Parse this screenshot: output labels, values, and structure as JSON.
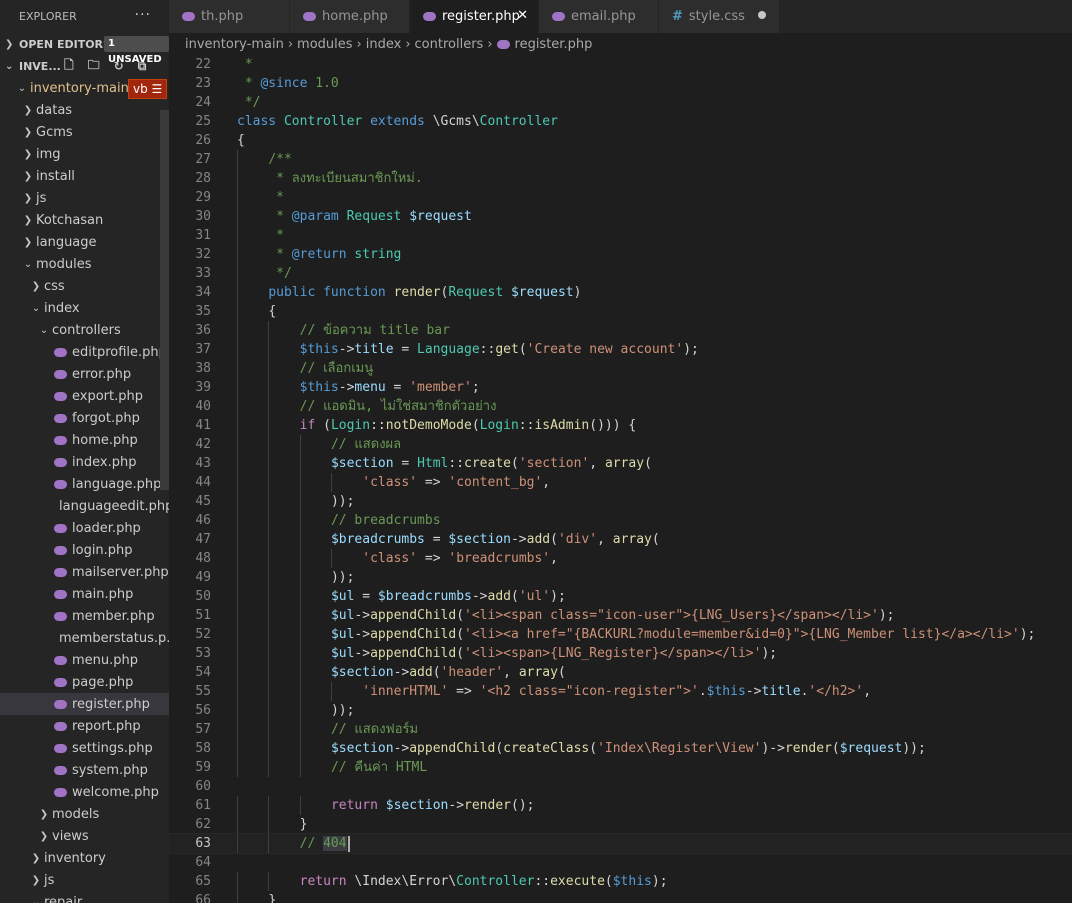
{
  "sidebar": {
    "title": "EXPLORER",
    "more": "···",
    "open_editors": "OPEN EDITORS",
    "unsaved": "1 UNSAVED",
    "workspace": "INVE...",
    "root_folder": "inventory-main",
    "root_badge": "vb",
    "tree": [
      {
        "label": "datas",
        "depth": 1,
        "type": "folder",
        "open": false
      },
      {
        "label": "Gcms",
        "depth": 1,
        "type": "folder",
        "open": false
      },
      {
        "label": "img",
        "depth": 1,
        "type": "folder",
        "open": false
      },
      {
        "label": "install",
        "depth": 1,
        "type": "folder",
        "open": false
      },
      {
        "label": "js",
        "depth": 1,
        "type": "folder",
        "open": false
      },
      {
        "label": "Kotchasan",
        "depth": 1,
        "type": "folder",
        "open": false
      },
      {
        "label": "language",
        "depth": 1,
        "type": "folder",
        "open": false
      },
      {
        "label": "modules",
        "depth": 1,
        "type": "folder",
        "open": true
      },
      {
        "label": "css",
        "depth": 2,
        "type": "folder",
        "open": false
      },
      {
        "label": "index",
        "depth": 2,
        "type": "folder",
        "open": true
      },
      {
        "label": "controllers",
        "depth": 3,
        "type": "folder",
        "open": true
      },
      {
        "label": "editprofile.php",
        "depth": 4,
        "type": "php"
      },
      {
        "label": "error.php",
        "depth": 4,
        "type": "php"
      },
      {
        "label": "export.php",
        "depth": 4,
        "type": "php"
      },
      {
        "label": "forgot.php",
        "depth": 4,
        "type": "php"
      },
      {
        "label": "home.php",
        "depth": 4,
        "type": "php"
      },
      {
        "label": "index.php",
        "depth": 4,
        "type": "php"
      },
      {
        "label": "language.php",
        "depth": 4,
        "type": "php"
      },
      {
        "label": "languageedit.php",
        "depth": 4,
        "type": "php"
      },
      {
        "label": "loader.php",
        "depth": 4,
        "type": "php"
      },
      {
        "label": "login.php",
        "depth": 4,
        "type": "php"
      },
      {
        "label": "mailserver.php",
        "depth": 4,
        "type": "php"
      },
      {
        "label": "main.php",
        "depth": 4,
        "type": "php"
      },
      {
        "label": "member.php",
        "depth": 4,
        "type": "php"
      },
      {
        "label": "memberstatus.p...",
        "depth": 4,
        "type": "php"
      },
      {
        "label": "menu.php",
        "depth": 4,
        "type": "php"
      },
      {
        "label": "page.php",
        "depth": 4,
        "type": "php"
      },
      {
        "label": "register.php",
        "depth": 4,
        "type": "php",
        "selected": true
      },
      {
        "label": "report.php",
        "depth": 4,
        "type": "php"
      },
      {
        "label": "settings.php",
        "depth": 4,
        "type": "php"
      },
      {
        "label": "system.php",
        "depth": 4,
        "type": "php"
      },
      {
        "label": "welcome.php",
        "depth": 4,
        "type": "php"
      },
      {
        "label": "models",
        "depth": 3,
        "type": "folder",
        "open": false
      },
      {
        "label": "views",
        "depth": 3,
        "type": "folder",
        "open": false
      },
      {
        "label": "inventory",
        "depth": 2,
        "type": "folder",
        "open": false
      },
      {
        "label": "js",
        "depth": 2,
        "type": "folder",
        "open": false
      },
      {
        "label": "repair",
        "depth": 2,
        "type": "folder",
        "open": true
      }
    ]
  },
  "tabs": [
    {
      "label": "th.php",
      "icon": "php-icon",
      "width": 121
    },
    {
      "label": "home.php",
      "icon": "php-icon",
      "width": 120
    },
    {
      "label": "register.php",
      "icon": "php-icon",
      "width": 129,
      "active": true
    },
    {
      "label": "email.php",
      "icon": "php-icon",
      "width": 120
    },
    {
      "label": "style.css",
      "icon": "css-icon",
      "width": 121,
      "dirty": true
    }
  ],
  "breadcrumb": [
    "inventory-main",
    "modules",
    "index",
    "controllers",
    "register.php"
  ],
  "editor": {
    "current_line": 63,
    "lines": [
      {
        "n": "22",
        "indent": 0,
        "tokens": [
          [
            " *",
            "c"
          ]
        ]
      },
      {
        "n": "23",
        "indent": 0,
        "tokens": [
          [
            " * ",
            "c"
          ],
          [
            "@since",
            "k"
          ],
          [
            " 1.0",
            "c"
          ]
        ]
      },
      {
        "n": "24",
        "indent": 0,
        "tokens": [
          [
            " */",
            "c"
          ]
        ]
      },
      {
        "n": "25",
        "indent": 0,
        "tokens": [
          [
            "class",
            "k"
          ],
          [
            " ",
            "d"
          ],
          [
            "Controller",
            "t"
          ],
          [
            " ",
            "d"
          ],
          [
            "extends",
            "k"
          ],
          [
            " \\Gcms\\",
            "d"
          ],
          [
            "Controller",
            "t"
          ]
        ]
      },
      {
        "n": "26",
        "indent": 0,
        "tokens": [
          [
            "{",
            "d"
          ]
        ]
      },
      {
        "n": "27",
        "indent": 1,
        "tokens": [
          [
            "/**",
            "c"
          ]
        ]
      },
      {
        "n": "28",
        "indent": 1,
        "tokens": [
          [
            " * ลงทะเบียนสมาชิกใหม่.",
            "c"
          ]
        ]
      },
      {
        "n": "29",
        "indent": 1,
        "tokens": [
          [
            " *",
            "c"
          ]
        ]
      },
      {
        "n": "30",
        "indent": 1,
        "tokens": [
          [
            " * ",
            "c"
          ],
          [
            "@param",
            "k"
          ],
          [
            " ",
            "c"
          ],
          [
            "Request",
            "t"
          ],
          [
            " ",
            "c"
          ],
          [
            "$request",
            "v"
          ]
        ]
      },
      {
        "n": "31",
        "indent": 1,
        "tokens": [
          [
            " *",
            "c"
          ]
        ]
      },
      {
        "n": "32",
        "indent": 1,
        "tokens": [
          [
            " * ",
            "c"
          ],
          [
            "@return",
            "k"
          ],
          [
            " ",
            "c"
          ],
          [
            "string",
            "t"
          ]
        ]
      },
      {
        "n": "33",
        "indent": 1,
        "tokens": [
          [
            " */",
            "c"
          ]
        ]
      },
      {
        "n": "34",
        "indent": 1,
        "tokens": [
          [
            "public",
            "k"
          ],
          [
            " ",
            "d"
          ],
          [
            "function",
            "k"
          ],
          [
            " ",
            "d"
          ],
          [
            "render",
            "f"
          ],
          [
            "(",
            "d"
          ],
          [
            "Request",
            "t"
          ],
          [
            " ",
            "d"
          ],
          [
            "$request",
            "v"
          ],
          [
            ")",
            "d"
          ]
        ]
      },
      {
        "n": "35",
        "indent": 1,
        "tokens": [
          [
            "{",
            "d"
          ]
        ]
      },
      {
        "n": "36",
        "indent": 2,
        "tokens": [
          [
            "// ข้อความ title bar",
            "c"
          ]
        ]
      },
      {
        "n": "37",
        "indent": 2,
        "tokens": [
          [
            "$this",
            "k"
          ],
          [
            "->",
            "d"
          ],
          [
            "title",
            "v"
          ],
          [
            " = ",
            "d"
          ],
          [
            "Language",
            "t"
          ],
          [
            "::",
            "d"
          ],
          [
            "get",
            "f"
          ],
          [
            "(",
            "d"
          ],
          [
            "'Create new account'",
            "s"
          ],
          [
            ");",
            "d"
          ]
        ]
      },
      {
        "n": "38",
        "indent": 2,
        "tokens": [
          [
            "// เลือกเมนู",
            "c"
          ]
        ]
      },
      {
        "n": "39",
        "indent": 2,
        "tokens": [
          [
            "$this",
            "k"
          ],
          [
            "->",
            "d"
          ],
          [
            "menu",
            "v"
          ],
          [
            " = ",
            "d"
          ],
          [
            "'member'",
            "s"
          ],
          [
            ";",
            "d"
          ]
        ]
      },
      {
        "n": "40",
        "indent": 2,
        "tokens": [
          [
            "// แอดมิน, ไม่ใช่สมาชิกตัวอย่าง",
            "c"
          ]
        ]
      },
      {
        "n": "41",
        "indent": 2,
        "tokens": [
          [
            "if",
            "ctl"
          ],
          [
            " (",
            "d"
          ],
          [
            "Login",
            "t"
          ],
          [
            "::",
            "d"
          ],
          [
            "notDemoMode",
            "f"
          ],
          [
            "(",
            "d"
          ],
          [
            "Login",
            "t"
          ],
          [
            "::",
            "d"
          ],
          [
            "isAdmin",
            "f"
          ],
          [
            "())) {",
            "d"
          ]
        ]
      },
      {
        "n": "42",
        "indent": 3,
        "tokens": [
          [
            "// แสดงผล",
            "c"
          ]
        ]
      },
      {
        "n": "43",
        "indent": 3,
        "tokens": [
          [
            "$section",
            "v"
          ],
          [
            " = ",
            "d"
          ],
          [
            "Html",
            "t"
          ],
          [
            "::",
            "d"
          ],
          [
            "create",
            "f"
          ],
          [
            "(",
            "d"
          ],
          [
            "'section'",
            "s"
          ],
          [
            ", ",
            "d"
          ],
          [
            "array",
            "f"
          ],
          [
            "(",
            "d"
          ]
        ]
      },
      {
        "n": "44",
        "indent": 4,
        "tokens": [
          [
            "'class'",
            "s"
          ],
          [
            " => ",
            "d"
          ],
          [
            "'content_bg'",
            "s"
          ],
          [
            ",",
            "d"
          ]
        ]
      },
      {
        "n": "45",
        "indent": 3,
        "tokens": [
          [
            "));",
            "d"
          ]
        ]
      },
      {
        "n": "46",
        "indent": 3,
        "tokens": [
          [
            "// breadcrumbs",
            "c"
          ]
        ]
      },
      {
        "n": "47",
        "indent": 3,
        "tokens": [
          [
            "$breadcrumbs",
            "v"
          ],
          [
            " = ",
            "d"
          ],
          [
            "$section",
            "v"
          ],
          [
            "->",
            "d"
          ],
          [
            "add",
            "f"
          ],
          [
            "(",
            "d"
          ],
          [
            "'div'",
            "s"
          ],
          [
            ", ",
            "d"
          ],
          [
            "array",
            "f"
          ],
          [
            "(",
            "d"
          ]
        ]
      },
      {
        "n": "48",
        "indent": 4,
        "tokens": [
          [
            "'class'",
            "s"
          ],
          [
            " => ",
            "d"
          ],
          [
            "'breadcrumbs'",
            "s"
          ],
          [
            ",",
            "d"
          ]
        ]
      },
      {
        "n": "49",
        "indent": 3,
        "tokens": [
          [
            "));",
            "d"
          ]
        ]
      },
      {
        "n": "50",
        "indent": 3,
        "tokens": [
          [
            "$ul",
            "v"
          ],
          [
            " = ",
            "d"
          ],
          [
            "$breadcrumbs",
            "v"
          ],
          [
            "->",
            "d"
          ],
          [
            "add",
            "f"
          ],
          [
            "(",
            "d"
          ],
          [
            "'ul'",
            "s"
          ],
          [
            ");",
            "d"
          ]
        ]
      },
      {
        "n": "51",
        "indent": 3,
        "tokens": [
          [
            "$ul",
            "v"
          ],
          [
            "->",
            "d"
          ],
          [
            "appendChild",
            "f"
          ],
          [
            "(",
            "d"
          ],
          [
            "'<li><span class=\"icon-user\">{LNG_Users}</span></li>'",
            "s"
          ],
          [
            ");",
            "d"
          ]
        ]
      },
      {
        "n": "52",
        "indent": 3,
        "tokens": [
          [
            "$ul",
            "v"
          ],
          [
            "->",
            "d"
          ],
          [
            "appendChild",
            "f"
          ],
          [
            "(",
            "d"
          ],
          [
            "'<li><a href=\"{BACKURL?module=member&id=0}\">{LNG_Member list}</a></li>'",
            "s"
          ],
          [
            ");",
            "d"
          ]
        ]
      },
      {
        "n": "53",
        "indent": 3,
        "tokens": [
          [
            "$ul",
            "v"
          ],
          [
            "->",
            "d"
          ],
          [
            "appendChild",
            "f"
          ],
          [
            "(",
            "d"
          ],
          [
            "'<li><span>{LNG_Register}</span></li>'",
            "s"
          ],
          [
            ");",
            "d"
          ]
        ]
      },
      {
        "n": "54",
        "indent": 3,
        "tokens": [
          [
            "$section",
            "v"
          ],
          [
            "->",
            "d"
          ],
          [
            "add",
            "f"
          ],
          [
            "(",
            "d"
          ],
          [
            "'header'",
            "s"
          ],
          [
            ", ",
            "d"
          ],
          [
            "array",
            "f"
          ],
          [
            "(",
            "d"
          ]
        ]
      },
      {
        "n": "55",
        "indent": 4,
        "tokens": [
          [
            "'innerHTML'",
            "s"
          ],
          [
            " => ",
            "d"
          ],
          [
            "'<h2 class=\"icon-register\">'",
            "s"
          ],
          [
            ".",
            "d"
          ],
          [
            "$this",
            "k"
          ],
          [
            "->",
            "d"
          ],
          [
            "title",
            "v"
          ],
          [
            ".",
            "d"
          ],
          [
            "'</h2>'",
            "s"
          ],
          [
            ",",
            "d"
          ]
        ]
      },
      {
        "n": "56",
        "indent": 3,
        "tokens": [
          [
            "));",
            "d"
          ]
        ]
      },
      {
        "n": "57",
        "indent": 3,
        "tokens": [
          [
            "// แสดงฟอร์ม",
            "c"
          ]
        ]
      },
      {
        "n": "58",
        "indent": 3,
        "tokens": [
          [
            "$section",
            "v"
          ],
          [
            "->",
            "d"
          ],
          [
            "appendChild",
            "f"
          ],
          [
            "(",
            "d"
          ],
          [
            "createClass",
            "f"
          ],
          [
            "(",
            "d"
          ],
          [
            "'Index\\Register\\View'",
            "s"
          ],
          [
            ")->",
            "d"
          ],
          [
            "render",
            "f"
          ],
          [
            "(",
            "d"
          ],
          [
            "$request",
            "v"
          ],
          [
            "));",
            "d"
          ]
        ]
      },
      {
        "n": "59",
        "indent": 3,
        "tokens": [
          [
            "// คืนค่า HTML",
            "c"
          ]
        ]
      },
      {
        "n": "60",
        "indent": 0,
        "tokens": []
      },
      {
        "n": "61",
        "indent": 3,
        "tokens": [
          [
            "return",
            "ctl"
          ],
          [
            " ",
            "d"
          ],
          [
            "$section",
            "v"
          ],
          [
            "->",
            "d"
          ],
          [
            "render",
            "f"
          ],
          [
            "();",
            "d"
          ]
        ]
      },
      {
        "n": "62",
        "indent": 2,
        "tokens": [
          [
            "}",
            "d"
          ]
        ]
      },
      {
        "n": "63",
        "indent": 2,
        "tokens": [
          [
            "// ",
            "c"
          ],
          [
            "404",
            "c hl"
          ]
        ],
        "cursor": true
      },
      {
        "n": "64",
        "indent": 0,
        "tokens": []
      },
      {
        "n": "65",
        "indent": 2,
        "tokens": [
          [
            "return",
            "ctl"
          ],
          [
            " \\Index\\Error\\",
            "d"
          ],
          [
            "Controller",
            "t"
          ],
          [
            "::",
            "d"
          ],
          [
            "execute",
            "f"
          ],
          [
            "(",
            "d"
          ],
          [
            "$this",
            "k"
          ],
          [
            ");",
            "d"
          ]
        ]
      },
      {
        "n": "66",
        "indent": 1,
        "tokens": [
          [
            "}",
            "d"
          ]
        ]
      }
    ]
  }
}
